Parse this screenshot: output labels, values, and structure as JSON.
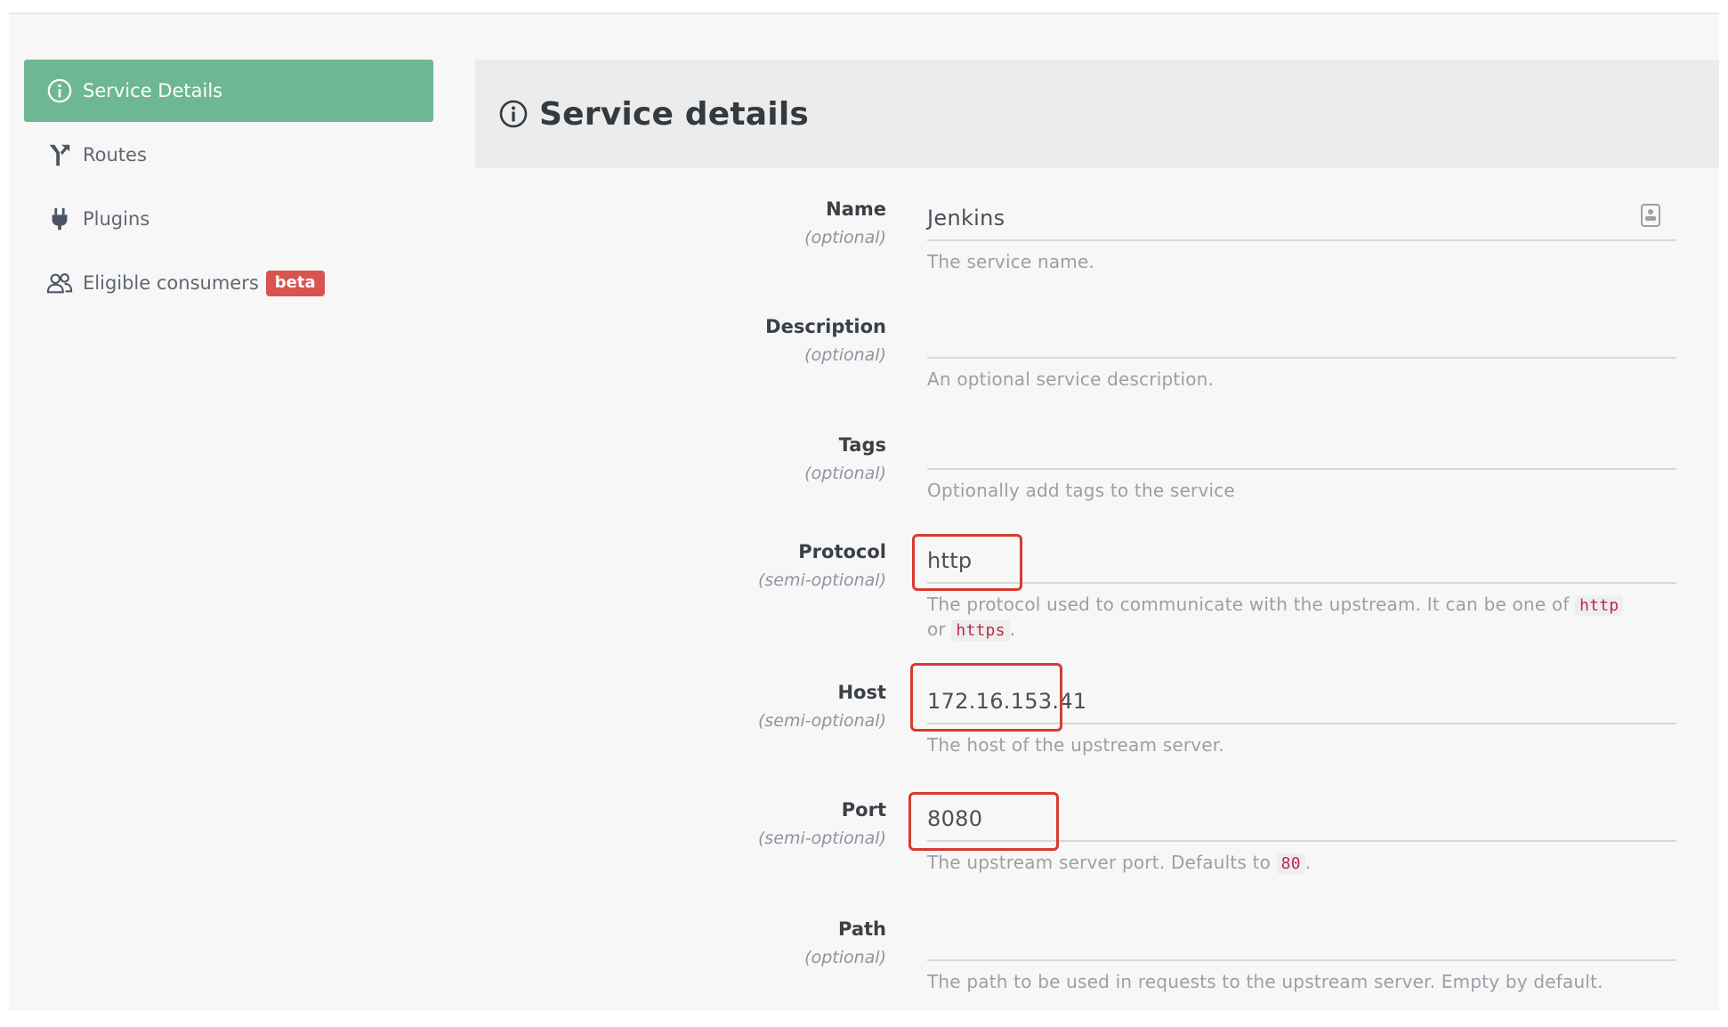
{
  "sidebar": {
    "items": [
      {
        "label": "Service Details",
        "icon": "info-circle-icon",
        "active": true
      },
      {
        "label": "Routes",
        "icon": "routes-icon",
        "active": false
      },
      {
        "label": "Plugins",
        "icon": "plug-icon",
        "active": false
      },
      {
        "label": "Eligible consumers",
        "icon": "users-icon",
        "active": false,
        "badge": "beta"
      }
    ]
  },
  "main": {
    "title": "Service details",
    "title_icon": "info-circle-icon"
  },
  "form": {
    "name": {
      "label": "Name",
      "note": "(optional)",
      "value": "Jenkins",
      "hint": "The service name."
    },
    "description": {
      "label": "Description",
      "note": "(optional)",
      "value": "",
      "hint": "An optional service description."
    },
    "tags": {
      "label": "Tags",
      "note": "(optional)",
      "value": "",
      "hint": "Optionally add tags to the service"
    },
    "protocol": {
      "label": "Protocol",
      "note": "(semi-optional)",
      "value": "http",
      "hint_pre": "The protocol used to communicate with the upstream. It can be one of",
      "code1": "http",
      "hint_mid": "or",
      "code2": "https",
      "hint_post": "."
    },
    "host": {
      "label": "Host",
      "note": "(semi-optional)",
      "value": "172.16.153.41",
      "hint": "The host of the upstream server."
    },
    "port": {
      "label": "Port",
      "note": "(semi-optional)",
      "value": "8080",
      "hint_pre": "The upstream server port. Defaults to",
      "code": "80",
      "hint_post": "."
    },
    "path": {
      "label": "Path",
      "note": "(optional)",
      "value": "",
      "hint": "The path to be used in requests to the upstream server. Empty by default."
    }
  },
  "colors": {
    "active_nav": "#6db793",
    "badge": "#d9534f",
    "highlight": "#d63b2f",
    "code_text": "#c0274a"
  }
}
